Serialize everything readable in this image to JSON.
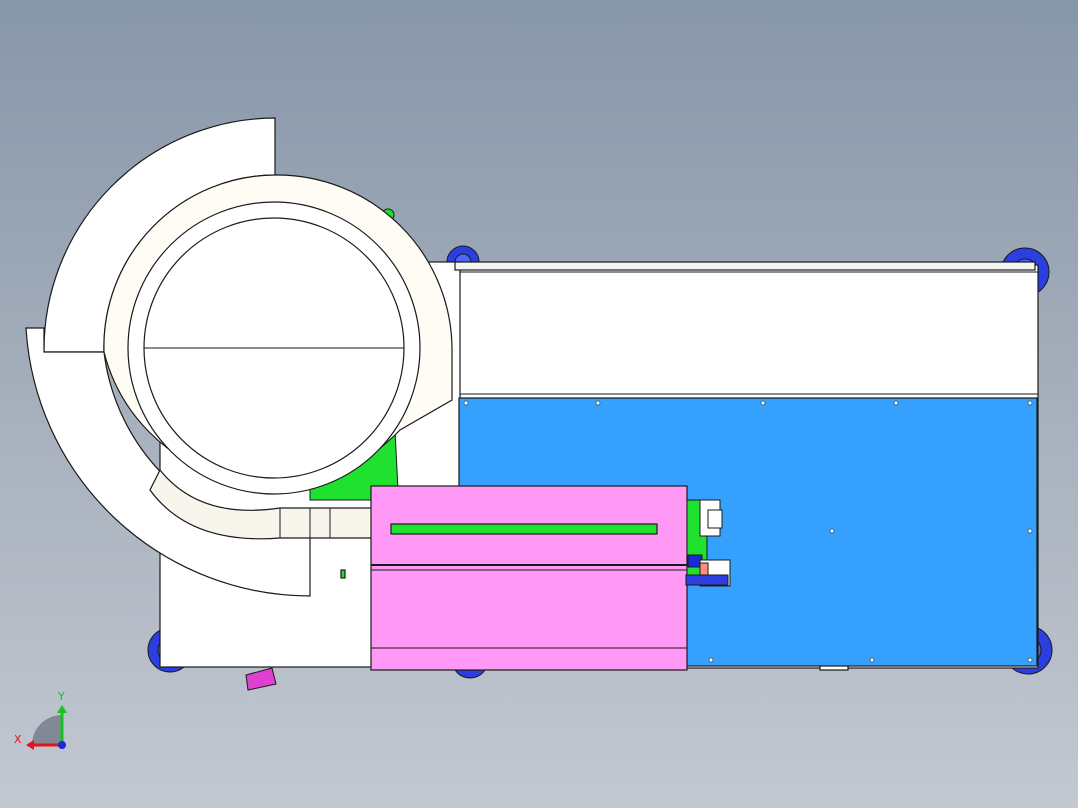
{
  "viewport": {
    "background_top": "#8796a9",
    "background_bottom": "#c3c8d1"
  },
  "triad": {
    "x_label": "X",
    "y_label": "Y",
    "x_color": "#e0141e",
    "y_color": "#18c020",
    "z_color": "#1a2ad8"
  },
  "colors": {
    "frame": "#ffffff",
    "panel_blue": "#36a0ff",
    "cover_pink": "#ff99f5",
    "bracket_green": "#20e030",
    "wheel_blue": "#2b3fe0",
    "outline": "#1a1a1a"
  },
  "parts": [
    "vibratory-bowl-feeder",
    "machine-frame",
    "blue-mounting-plate",
    "pink-protective-cover",
    "green-feeder-bracket",
    "caster-wheels",
    "linear-conveyor-track",
    "pick-and-place-module"
  ]
}
